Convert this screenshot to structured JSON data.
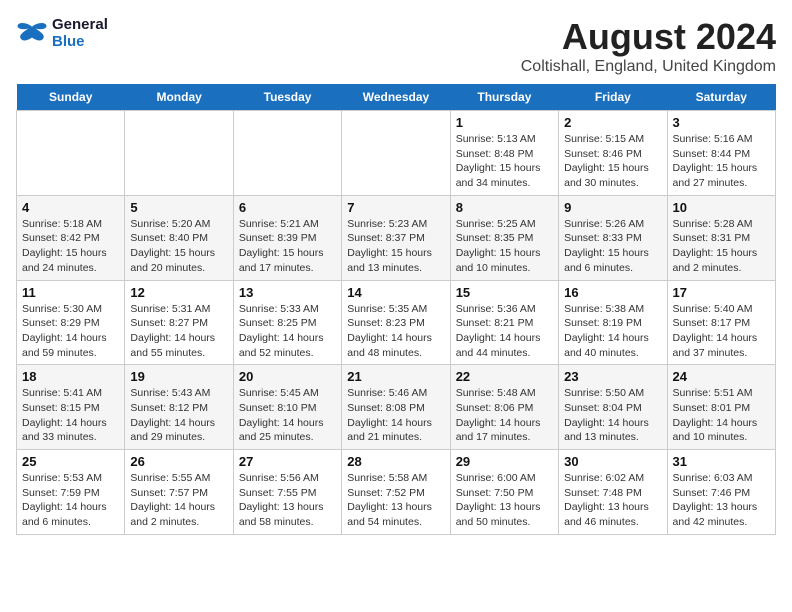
{
  "header": {
    "logo_line1": "General",
    "logo_line2": "Blue",
    "title": "August 2024",
    "subtitle": "Coltishall, England, United Kingdom"
  },
  "days_of_week": [
    "Sunday",
    "Monday",
    "Tuesday",
    "Wednesday",
    "Thursday",
    "Friday",
    "Saturday"
  ],
  "weeks": [
    [
      {
        "date": "",
        "info": ""
      },
      {
        "date": "",
        "info": ""
      },
      {
        "date": "",
        "info": ""
      },
      {
        "date": "",
        "info": ""
      },
      {
        "date": "1",
        "info": "Sunrise: 5:13 AM\nSunset: 8:48 PM\nDaylight: 15 hours\nand 34 minutes."
      },
      {
        "date": "2",
        "info": "Sunrise: 5:15 AM\nSunset: 8:46 PM\nDaylight: 15 hours\nand 30 minutes."
      },
      {
        "date": "3",
        "info": "Sunrise: 5:16 AM\nSunset: 8:44 PM\nDaylight: 15 hours\nand 27 minutes."
      }
    ],
    [
      {
        "date": "4",
        "info": "Sunrise: 5:18 AM\nSunset: 8:42 PM\nDaylight: 15 hours\nand 24 minutes."
      },
      {
        "date": "5",
        "info": "Sunrise: 5:20 AM\nSunset: 8:40 PM\nDaylight: 15 hours\nand 20 minutes."
      },
      {
        "date": "6",
        "info": "Sunrise: 5:21 AM\nSunset: 8:39 PM\nDaylight: 15 hours\nand 17 minutes."
      },
      {
        "date": "7",
        "info": "Sunrise: 5:23 AM\nSunset: 8:37 PM\nDaylight: 15 hours\nand 13 minutes."
      },
      {
        "date": "8",
        "info": "Sunrise: 5:25 AM\nSunset: 8:35 PM\nDaylight: 15 hours\nand 10 minutes."
      },
      {
        "date": "9",
        "info": "Sunrise: 5:26 AM\nSunset: 8:33 PM\nDaylight: 15 hours\nand 6 minutes."
      },
      {
        "date": "10",
        "info": "Sunrise: 5:28 AM\nSunset: 8:31 PM\nDaylight: 15 hours\nand 2 minutes."
      }
    ],
    [
      {
        "date": "11",
        "info": "Sunrise: 5:30 AM\nSunset: 8:29 PM\nDaylight: 14 hours\nand 59 minutes."
      },
      {
        "date": "12",
        "info": "Sunrise: 5:31 AM\nSunset: 8:27 PM\nDaylight: 14 hours\nand 55 minutes."
      },
      {
        "date": "13",
        "info": "Sunrise: 5:33 AM\nSunset: 8:25 PM\nDaylight: 14 hours\nand 52 minutes."
      },
      {
        "date": "14",
        "info": "Sunrise: 5:35 AM\nSunset: 8:23 PM\nDaylight: 14 hours\nand 48 minutes."
      },
      {
        "date": "15",
        "info": "Sunrise: 5:36 AM\nSunset: 8:21 PM\nDaylight: 14 hours\nand 44 minutes."
      },
      {
        "date": "16",
        "info": "Sunrise: 5:38 AM\nSunset: 8:19 PM\nDaylight: 14 hours\nand 40 minutes."
      },
      {
        "date": "17",
        "info": "Sunrise: 5:40 AM\nSunset: 8:17 PM\nDaylight: 14 hours\nand 37 minutes."
      }
    ],
    [
      {
        "date": "18",
        "info": "Sunrise: 5:41 AM\nSunset: 8:15 PM\nDaylight: 14 hours\nand 33 minutes."
      },
      {
        "date": "19",
        "info": "Sunrise: 5:43 AM\nSunset: 8:12 PM\nDaylight: 14 hours\nand 29 minutes."
      },
      {
        "date": "20",
        "info": "Sunrise: 5:45 AM\nSunset: 8:10 PM\nDaylight: 14 hours\nand 25 minutes."
      },
      {
        "date": "21",
        "info": "Sunrise: 5:46 AM\nSunset: 8:08 PM\nDaylight: 14 hours\nand 21 minutes."
      },
      {
        "date": "22",
        "info": "Sunrise: 5:48 AM\nSunset: 8:06 PM\nDaylight: 14 hours\nand 17 minutes."
      },
      {
        "date": "23",
        "info": "Sunrise: 5:50 AM\nSunset: 8:04 PM\nDaylight: 14 hours\nand 13 minutes."
      },
      {
        "date": "24",
        "info": "Sunrise: 5:51 AM\nSunset: 8:01 PM\nDaylight: 14 hours\nand 10 minutes."
      }
    ],
    [
      {
        "date": "25",
        "info": "Sunrise: 5:53 AM\nSunset: 7:59 PM\nDaylight: 14 hours\nand 6 minutes."
      },
      {
        "date": "26",
        "info": "Sunrise: 5:55 AM\nSunset: 7:57 PM\nDaylight: 14 hours\nand 2 minutes."
      },
      {
        "date": "27",
        "info": "Sunrise: 5:56 AM\nSunset: 7:55 PM\nDaylight: 13 hours\nand 58 minutes."
      },
      {
        "date": "28",
        "info": "Sunrise: 5:58 AM\nSunset: 7:52 PM\nDaylight: 13 hours\nand 54 minutes."
      },
      {
        "date": "29",
        "info": "Sunrise: 6:00 AM\nSunset: 7:50 PM\nDaylight: 13 hours\nand 50 minutes."
      },
      {
        "date": "30",
        "info": "Sunrise: 6:02 AM\nSunset: 7:48 PM\nDaylight: 13 hours\nand 46 minutes."
      },
      {
        "date": "31",
        "info": "Sunrise: 6:03 AM\nSunset: 7:46 PM\nDaylight: 13 hours\nand 42 minutes."
      }
    ]
  ]
}
